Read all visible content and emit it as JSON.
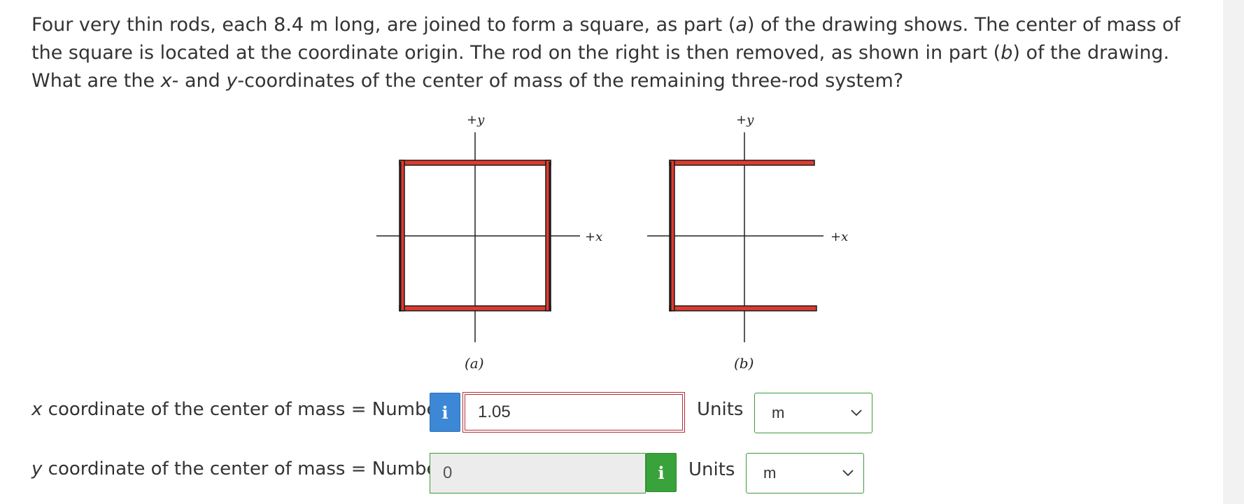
{
  "question": {
    "part1": "Four very thin rods, each 8.4 m long, are joined to form a square, as part (",
    "a_letter": "a",
    "part2": ") of the drawing shows. The center of mass of the square is located at the coordinate origin. The rod on the right is then removed, as shown in part (",
    "b_letter": "b",
    "part3": ") of the drawing. What are the ",
    "x_var": "x",
    "part4": "- and ",
    "y_var": "y",
    "part5": "-coordinates of the center of mass of the remaining three-rod system?"
  },
  "figure": {
    "axis_y_label": "+y",
    "axis_x_label": "+x",
    "caption_a": "(a)",
    "caption_b": "(b)",
    "rod_color": "#e03a2e",
    "rod_edge_color": "#1a1a1a"
  },
  "answers": {
    "x_row": {
      "var": "x",
      "label": " coordinate of the center of mass = Number",
      "info_icon": "i",
      "value": "1.05",
      "units_label": "Units",
      "units_value": "m"
    },
    "y_row": {
      "var": "y",
      "label": " coordinate of the center of mass = Number",
      "info_icon": "i",
      "value": "0",
      "units_label": "Units",
      "units_value": "m"
    }
  },
  "colors": {
    "info_blue": "#3d88d6",
    "info_green": "#3aa23a",
    "incorrect_border": "#b3303a",
    "correct_border": "#3d9b3d"
  }
}
